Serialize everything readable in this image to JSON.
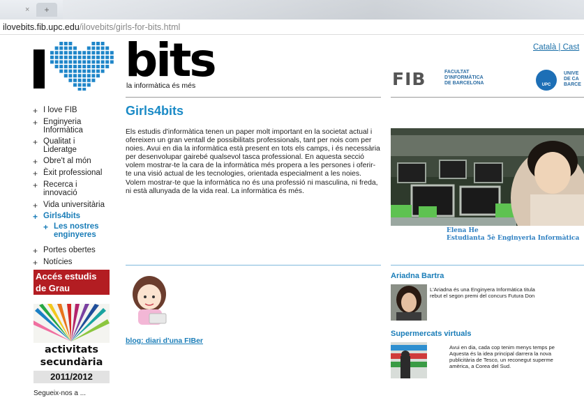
{
  "browser": {
    "tab_close": "×",
    "new_tab": "+",
    "url_host": "ilovebits.fib.upc.edu",
    "url_path": "/ilovebits/girls-for-bits.html"
  },
  "header": {
    "logo_letter": "I",
    "logo_word": "bits",
    "tagline": "la informàtica és més",
    "languages": "Català | Cast",
    "fib_letters": "FIB",
    "fib_line1": "FACULTAT",
    "fib_line2": "D'INFORMÀTICA",
    "fib_line3": "DE BARCELONA",
    "upc_label": "UPC",
    "upc_line1": "UNIVE",
    "upc_line2": "DE CA",
    "upc_line3": "BARCE"
  },
  "nav": {
    "items": [
      {
        "label": "I love FIB"
      },
      {
        "label": "Enginyeria\nInformàtica"
      },
      {
        "label": "Qualitat i\nLideratge"
      },
      {
        "label": "Obre't al món"
      },
      {
        "label": "Èxit professional"
      },
      {
        "label": "Recerca i\ninnovació"
      },
      {
        "label": "Vida universitària"
      },
      {
        "label": "Girls4bits"
      },
      {
        "label": "Les nostres\nenginyeres"
      },
      {
        "label": "Portes obertes"
      },
      {
        "label": "Notícies"
      }
    ],
    "plus": "+"
  },
  "sidebar": {
    "acces_line1": "Accés estudis",
    "acces_line2": "de Grau",
    "activitats_line1": "activitats",
    "activitats_line2": "secundària",
    "year": "2011/2012",
    "follow": "Segueix-nos a ..."
  },
  "main": {
    "title": "Girls4bits",
    "intro": "Els estudis d'informàtica tenen un paper molt important en la societat actual i ofereixen un gran ventall de possibilitats professionals, tant per nois com per noies. Avui en dia la informàtica està present en tots els camps, i és necessària per desenvolupar gairebé qualsevol tasca professional. En aquesta secció volem mostrar-te la cara de la informàtica més propera a les persones i oferir-te una visió actual de les tecnologies, orientada especialment a les noies. Volem mostrar-te que la informàtica no és una professió ni masculina, ni freda, ni està allunyada de la vida real. La informàtica és més.",
    "hero_name": "Elena He",
    "hero_role": "Estudianta 5è Enginyeria Informàtica",
    "blog_link": "blog: diari d'una FIBer"
  },
  "news": [
    {
      "title": "Ariadna Bartra",
      "line1": "L'Ariadna és una Enginyera Informàtica titula",
      "line2": "rebut el segon premi del concurs Futura Don"
    },
    {
      "title": "Supermercats virtuals",
      "line1": "Avui en dia, cada cop tenim menys temps pe",
      "line2": "Aquesta és la idea principal darrera la nova",
      "line3": "publicitària de Tesco, un reconegut superme",
      "line4": "amèrica, a Corea del Sud."
    }
  ],
  "colors": {
    "accent": "#1a8ac6",
    "link": "#1a7db8",
    "banner_red": "#b31d22",
    "fib_red": "#d52b1e"
  }
}
